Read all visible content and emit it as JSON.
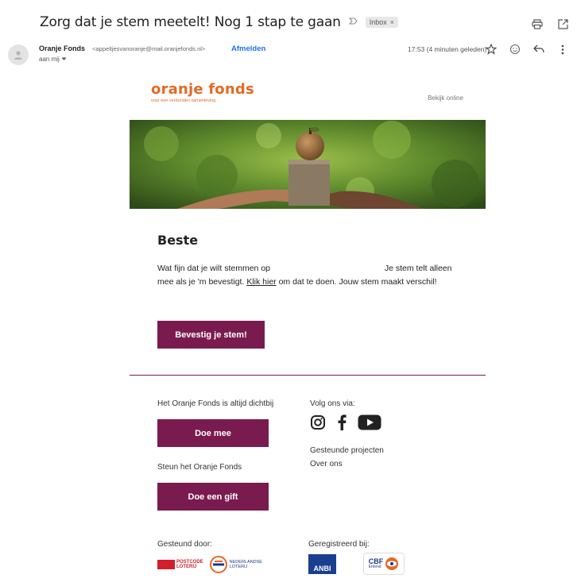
{
  "header": {
    "subject": "Zorg dat je stem meetelt! Nog 1 stap te gaan",
    "label": "Inbox",
    "label_close": "×"
  },
  "sender": {
    "name": "Oranje Fonds",
    "email": "<appeltjesvanoranje@mail.oranjefonds.nl>",
    "unsubscribe": "Afmelden",
    "to": "aan mij",
    "timestamp": "17:53 (4 minuten geleden)"
  },
  "email": {
    "brand_name": "oranje fonds",
    "brand_tagline": "voor een verbonden samenleving",
    "view_online": "Bekijk online",
    "greeting": "Beste",
    "body_part1": "Wat fijn dat je wilt stemmen op",
    "body_part2": "Je stem telt alleen mee als je 'm bevestigt.",
    "body_link": "Klik hier",
    "body_part3": "om dat te doen. Jouw stem maakt verschil!",
    "cta_label": "Bevestig je stem!",
    "footer": {
      "always_close": "Het Oranje Fonds is altijd dichtbij",
      "join_button": "Doe mee",
      "support_text": "Steun het Oranje Fonds",
      "gift_button": "Doe een gift",
      "follow_text": "Volg ons via:",
      "link_projects": "Gesteunde projecten",
      "link_about": "Over ons",
      "supported_by": "Gesteund door:",
      "registered_at": "Geregistreerd bij:",
      "postcode_line1": "POSTCODE",
      "postcode_line2": "LOTERIJ",
      "nl_line1": "NEDERLANDSE",
      "nl_line2": "LOTERIJ",
      "anbi": "ANBI",
      "cbf": "CBF",
      "cbf_sub": "Erkend"
    }
  },
  "colors": {
    "brand_orange": "#e36a25",
    "brand_purple": "#7a1b4f",
    "link_blue": "#1a73e8"
  }
}
